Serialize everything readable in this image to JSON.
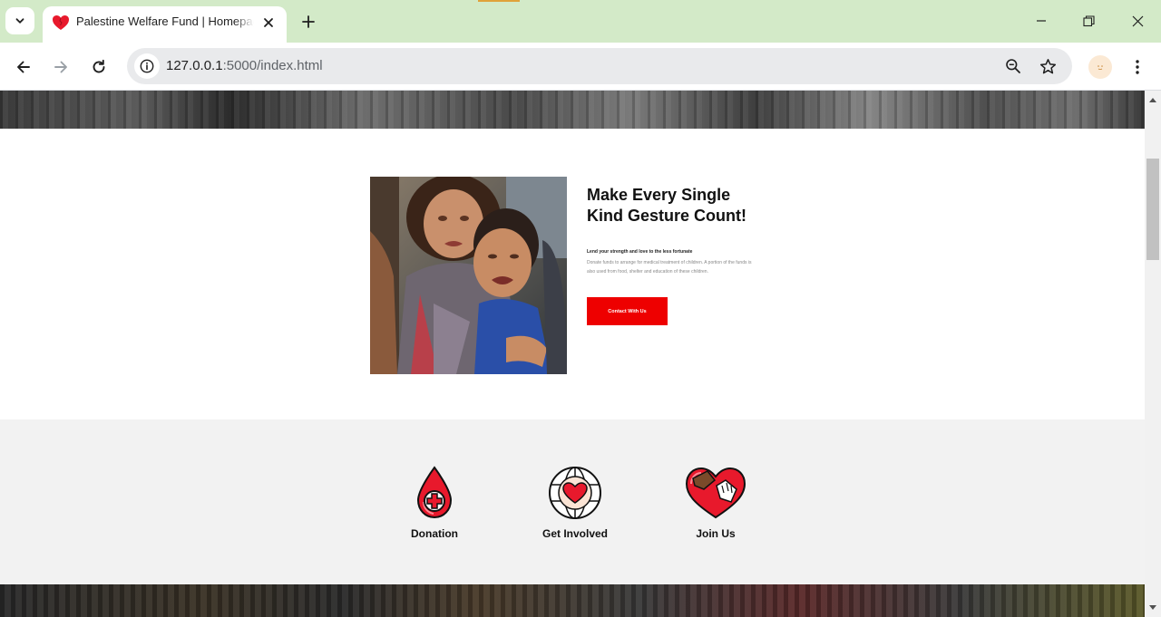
{
  "browser": {
    "tab": {
      "title": "Palestine Welfare Fund | Homepage",
      "favicon": "heart-icon"
    },
    "address_bar": {
      "host": "127.0.0.1",
      "path": ":5000/index.html"
    },
    "icons": {
      "tab_list": "chevron-down-icon",
      "close_tab": "close-icon",
      "new_tab": "plus-icon",
      "minimize": "minimize-icon",
      "restore": "restore-icon",
      "close_window": "close-icon",
      "back": "arrow-left-icon",
      "forward": "arrow-right-icon",
      "reload": "reload-icon",
      "site_info": "info-icon",
      "zoom": "zoom-out-icon",
      "bookmark": "star-icon",
      "profile": "profile-avatar",
      "menu": "kebab-menu-icon"
    }
  },
  "about": {
    "title": "Make Every Single Kind Gesture Count!",
    "subtitle": "Lend your strength and love to the less fortunate",
    "body": "Donate funds to arrange for medical treatment of children. A portion of the funds is also used from food, shelter and education of these children.",
    "cta_label": "Contact With Us"
  },
  "features": [
    {
      "label": "Donation",
      "icon": "blood-drop-cross-icon"
    },
    {
      "label": "Get Involved",
      "icon": "globe-heart-icon"
    },
    {
      "label": "Join Us",
      "icon": "heart-hands-icon"
    }
  ],
  "colors": {
    "tabbar_bg": "#d3eac8",
    "accent_red": "#ee0000",
    "features_bg": "#f2f2f2",
    "scroll_thumb": "#c1c1c1"
  }
}
